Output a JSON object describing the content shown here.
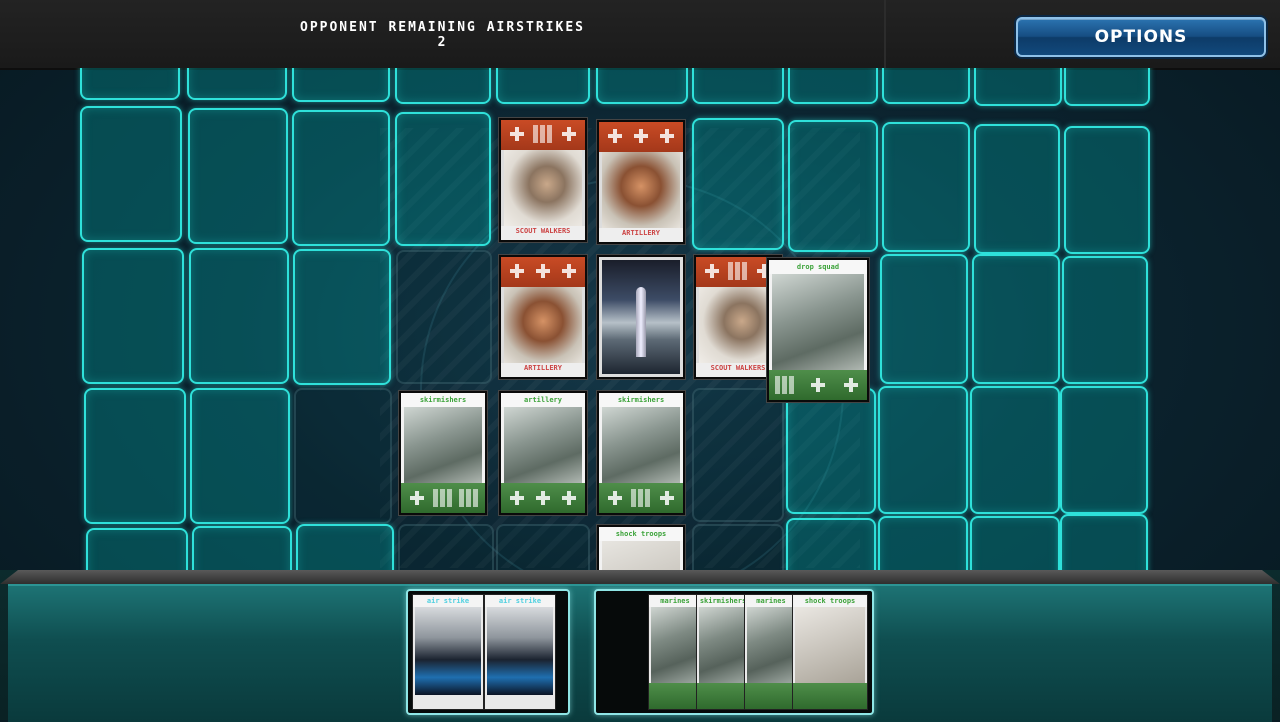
{
  "header": {
    "airstrike_title": "OPPONENT REMAINING AIRSTRIKES",
    "airstrike_count": "2",
    "options_label": "OPTIONS"
  },
  "colors": {
    "slot_highlight": "#2fe1da",
    "enemy_band": "#c94b25",
    "ally_band": "#3f7d3b",
    "options_button": "#1b5c95"
  },
  "board": {
    "cards": [
      {
        "side": "enemy",
        "title": "SCOUT WALKERS",
        "icon": "walker-mech-art"
      },
      {
        "side": "enemy",
        "title": "ARTILLERY",
        "icon": "heavy-mech-art"
      },
      {
        "side": "enemy",
        "title": "ARTILLERY",
        "icon": "heavy-mech-art"
      },
      {
        "side": "neutral",
        "title": "",
        "icon": "rocket-launch-art"
      },
      {
        "side": "enemy",
        "title": "SCOUT WALKERS",
        "icon": "walker-mech-art"
      },
      {
        "side": "ally",
        "title": "DROP SQUAD",
        "icon": "drop-squad-art"
      },
      {
        "side": "ally",
        "title": "SKIRMISHERS",
        "icon": "skirmisher-art"
      },
      {
        "side": "ally",
        "title": "ARTILLERY",
        "icon": "artillery-cannon-art"
      },
      {
        "side": "ally",
        "title": "SKIRMISHERS",
        "icon": "skirmisher-art"
      },
      {
        "side": "ally",
        "title": "SHOCK TROOPS",
        "icon": "shock-troops-art"
      }
    ]
  },
  "hand": {
    "airstrikes": [
      {
        "title": "AIR STRIKE"
      },
      {
        "title": "AIR STRIKE"
      }
    ],
    "units": [
      {
        "title": "MARINES"
      },
      {
        "title": "SKIRMISHERS"
      },
      {
        "title": "MARINES"
      },
      {
        "title": "SHOCK TROOPS"
      }
    ]
  }
}
